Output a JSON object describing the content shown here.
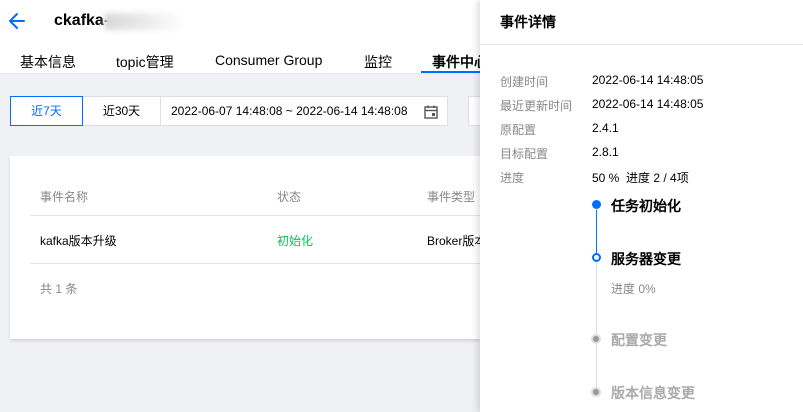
{
  "header": {
    "title": "ckafka-",
    "back_icon": "arrow-left-icon"
  },
  "tabs": [
    {
      "label": "基本信息"
    },
    {
      "label": "topic管理"
    },
    {
      "label": "Consumer Group"
    },
    {
      "label": "监控"
    },
    {
      "label": "事件中心",
      "active": true
    }
  ],
  "filters": {
    "quick_ranges": [
      "近7天",
      "近30天"
    ],
    "selected_range": "近7天",
    "date_range": "2022-06-07 14:48:08 ~ 2022-06-14 14:48:08",
    "calendar_icon": "calendar-icon"
  },
  "table": {
    "columns": [
      "事件名称",
      "状态",
      "事件类型"
    ],
    "rows": [
      {
        "name": "kafka版本升级",
        "status": "初始化",
        "type": "Broker版本"
      }
    ],
    "total": "共 1 条"
  },
  "drawer": {
    "title": "事件详情",
    "fields": [
      {
        "label": "创建时间",
        "value": "2022-06-14 14:48:05"
      },
      {
        "label": "最近更新时间",
        "value": "2022-06-14 14:48:05"
      },
      {
        "label": "原配置",
        "value": "2.4.1"
      },
      {
        "label": "目标配置",
        "value": "2.8.1"
      },
      {
        "label": "进度",
        "value": "50 %  进度 2 / 4项"
      }
    ],
    "steps": [
      {
        "title": "任务初始化",
        "state": "done"
      },
      {
        "title": "服务器变更",
        "state": "current",
        "sub": "进度 0%"
      },
      {
        "title": "配置变更",
        "state": "pending"
      },
      {
        "title": "版本信息变更",
        "state": "pending"
      }
    ]
  },
  "colors": {
    "primary": "#006eff",
    "success": "#0abf5b",
    "muted": "#888888",
    "background": "#f0f1f5"
  }
}
